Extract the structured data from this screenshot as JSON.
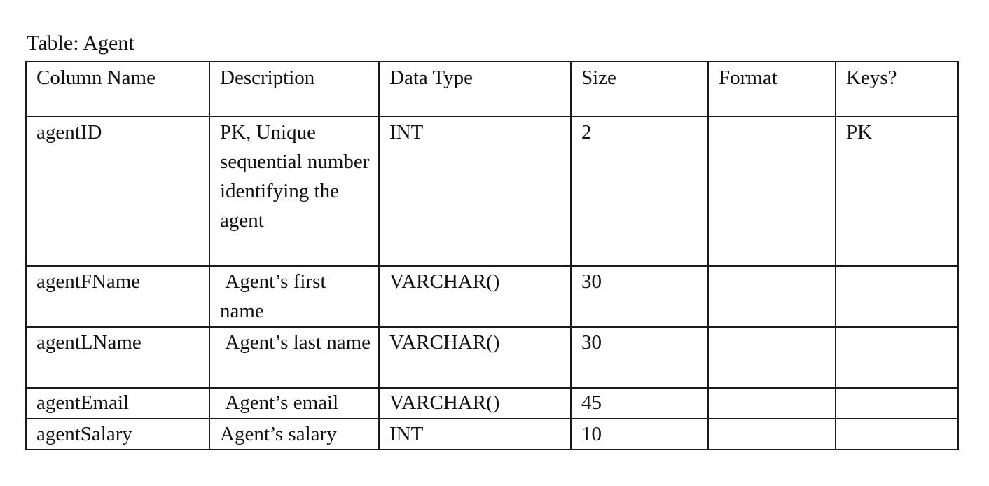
{
  "caption": "Table: Agent",
  "headers": {
    "column_name": "Column Name",
    "description": "Description",
    "data_type": "Data Type",
    "size": "Size",
    "format": "Format",
    "keys": "Keys?"
  },
  "rows": [
    {
      "column_name": "agentID",
      "description": "PK, Unique sequential number identifying the agent",
      "data_type": "INT",
      "size": "2",
      "format": "",
      "keys": "PK"
    },
    {
      "column_name": "agentFName",
      "description": " Agent’s first name",
      "data_type": "VARCHAR()",
      "size": "30",
      "format": "",
      "keys": ""
    },
    {
      "column_name": "agentLName",
      "description": " Agent’s last name",
      "data_type": "VARCHAR()",
      "size": "30",
      "format": "",
      "keys": ""
    },
    {
      "column_name": "agentEmail",
      "description": " Agent’s email",
      "data_type": "VARCHAR()",
      "size": "45",
      "format": "",
      "keys": ""
    },
    {
      "column_name": "agentSalary",
      "description": "Agent’s salary",
      "data_type": "INT",
      "size": "10",
      "format": "",
      "keys": ""
    }
  ]
}
